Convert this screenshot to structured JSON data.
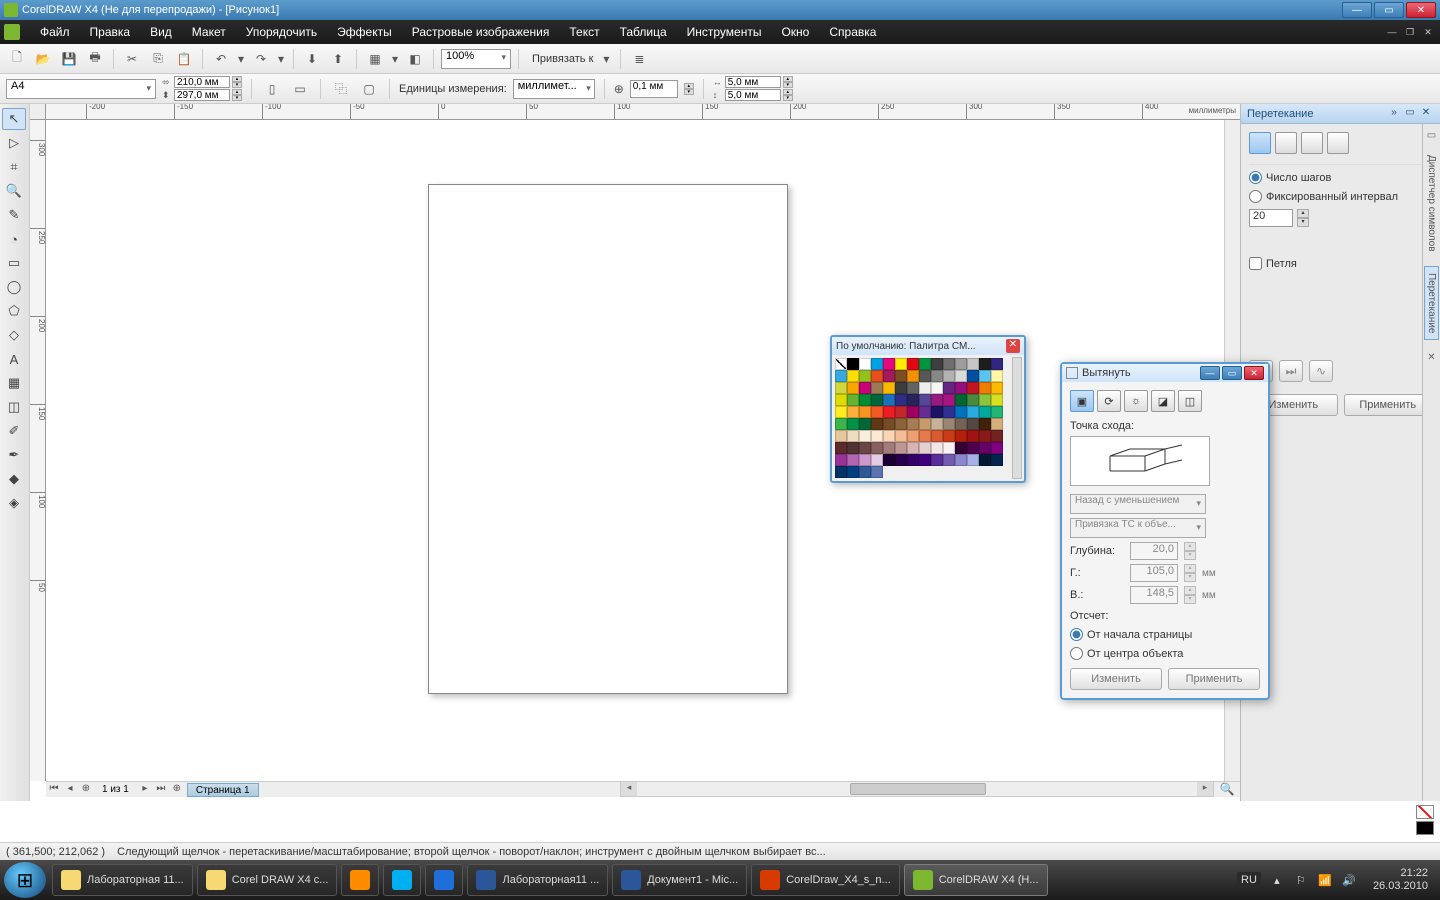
{
  "title": "CorelDRAW X4 (Не для перепродажи) - [Рисунок1]",
  "menu": [
    "Файл",
    "Правка",
    "Вид",
    "Макет",
    "Упорядочить",
    "Эффекты",
    "Растровые изображения",
    "Текст",
    "Таблица",
    "Инструменты",
    "Окно",
    "Справка"
  ],
  "toolbar": {
    "zoom": "100%",
    "snap_label": "Привязать к"
  },
  "propbar": {
    "paper": "A4",
    "width": "210,0 мм",
    "height": "297,0 мм",
    "units_label": "Единицы измерения:",
    "units": "миллимет...",
    "nudge": "0,1 мм",
    "dup_x": "5,0 мм",
    "dup_y": "5,0 мм"
  },
  "ruler_unit": "миллиметры",
  "ruler_marks_h": [
    -200,
    -150,
    -100,
    -50,
    0,
    50,
    100,
    150,
    200,
    250,
    300,
    350,
    400
  ],
  "ruler_marks_v": [
    300,
    250,
    200,
    150,
    100,
    50
  ],
  "page_nav": {
    "counter": "1 из 1",
    "tab": "Страница 1"
  },
  "status": {
    "coords": "( 361,500; 212,062 )",
    "hint": "Следующий щелчок - перетаскивание/масштабирование; второй щелчок - поворот/наклон; инструмент с двойным щелчком выбирает вс..."
  },
  "docker": {
    "title": "Перетекание",
    "mode_steps": "Число шагов",
    "mode_fixed": "Фиксированный интервал",
    "steps": "20",
    "loop": "Петля",
    "btn_edit": "Изменить",
    "btn_apply": "Применить"
  },
  "vtabs": {
    "sym": "Диспетчер символов",
    "blend": "Перетекание"
  },
  "palette": {
    "title": "По умолчанию: Палитра СМ..."
  },
  "extrude": {
    "title": "Вытянуть",
    "vp_label": "Точка схода:",
    "type": "Назад с уменьшением",
    "lock": "Привязка ТС к объе...",
    "depth_label": "Глубина:",
    "depth": "20,0",
    "h_label": "Г.:",
    "h": "105,0",
    "v_label": "В.:",
    "v": "148,5",
    "unit": "мм",
    "origin_label": "Отсчет:",
    "origin_page": "От начала страницы",
    "origin_obj": "От центра объекта",
    "btn_edit": "Изменить",
    "btn_apply": "Применить"
  },
  "swatch_colors": [
    "#000",
    "#fff",
    "#00a0e3",
    "#e5097f",
    "#ffed00",
    "#e30613",
    "#009640",
    "#3f3f3f",
    "#706f6f",
    "#9d9d9c",
    "#c6c6c6",
    "#1d1d1b",
    "#312783",
    "#36a9e1",
    "#ffde00",
    "#95c11f",
    "#e94e1b",
    "#a3195b",
    "#7d4e24",
    "#f39200",
    "#575756",
    "#878787",
    "#b2b2b2",
    "#dadada",
    "#004f9f",
    "#5bc5f2",
    "#fff6a3",
    "#d0d93c",
    "#f6a800",
    "#c8007b",
    "#9b7b56",
    "#fab900",
    "#3c3c3b",
    "#646363",
    "#ededed",
    "#f6f6f6",
    "#662483",
    "#93117e",
    "#be1622",
    "#ef7d00",
    "#fbba00",
    "#dedc00",
    "#65b32e",
    "#008d36",
    "#00653b",
    "#1d71b8",
    "#2d2e83",
    "#29235c",
    "#574696",
    "#951b81",
    "#a71680",
    "#006633",
    "#4a8a3f",
    "#8cc63f",
    "#d9e021",
    "#fcee21",
    "#fbb03b",
    "#f7931e",
    "#f15a24",
    "#ed1c24",
    "#c1272d",
    "#9e005d",
    "#662d91",
    "#1b1464",
    "#2e3192",
    "#0071bc",
    "#29abe2",
    "#00a99d",
    "#22b573",
    "#39b54a",
    "#009245",
    "#006837",
    "#603813",
    "#754c24",
    "#8c6239",
    "#a67c52",
    "#c69c6d",
    "#c7b299",
    "#998675",
    "#736357",
    "#534741",
    "#42210b",
    "#d4af7a",
    "#e6c79c",
    "#f0dcc0",
    "#f9eedc",
    "#fce8d4",
    "#fad5b8",
    "#f5bd95",
    "#ee9e6f",
    "#e57b4c",
    "#d85a2e",
    "#c93c17",
    "#b61f09",
    "#a11212",
    "#8a1a1a",
    "#732222",
    "#5c2a2a",
    "#4f3333",
    "#6b4545",
    "#876060",
    "#a37b7b",
    "#bf9696",
    "#d6b4b4",
    "#e6cfcf",
    "#f2e6e6",
    "#faf2f2",
    "#330033",
    "#4d004d",
    "#660066",
    "#800080",
    "#993399",
    "#b266b2",
    "#cc99cc",
    "#e5cce5",
    "#190033",
    "#26004d",
    "#330066",
    "#400080",
    "#592d99",
    "#735ab2",
    "#8c86cc",
    "#a6b2e5",
    "#001933",
    "#00264d",
    "#003366",
    "#004080",
    "#2d5999",
    "#5a73b2"
  ],
  "taskbar": {
    "items": [
      {
        "label": "Лабораторная 11...",
        "color": "#f8d775"
      },
      {
        "label": "Corel DRAW X4 с...",
        "color": "#f8d775"
      },
      {
        "label": "",
        "color": "#ff8c00"
      },
      {
        "label": "",
        "color": "#00aff0"
      },
      {
        "label": "",
        "color": "#1e6fd9"
      },
      {
        "label": "Лабораторная11 ...",
        "color": "#2b579a"
      },
      {
        "label": "Документ1 - Mic...",
        "color": "#2b579a"
      },
      {
        "label": "CorelDraw_X4_s_n...",
        "color": "#d83b01"
      },
      {
        "label": "CorelDRAW X4 (Н...",
        "color": "#7cb82f"
      }
    ],
    "lang": "RU",
    "time": "21:22",
    "date": "26.03.2010"
  }
}
